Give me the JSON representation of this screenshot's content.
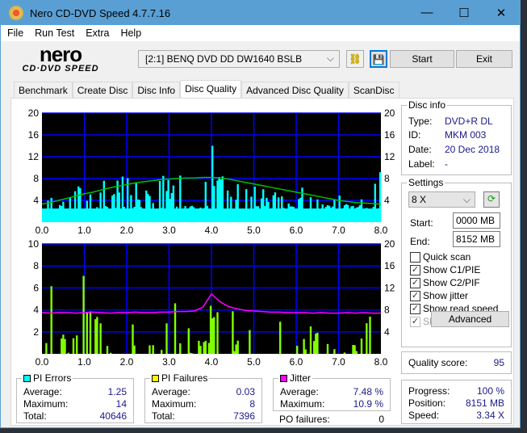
{
  "window": {
    "title": "Nero CD-DVD Speed 4.7.7.16"
  },
  "menu": [
    "File",
    "Run Test",
    "Extra",
    "Help"
  ],
  "toolbar": {
    "logo_top": "nero",
    "logo_bottom": "CD·DVD SPEED",
    "drive": "[2:1]   BENQ DVD DD DW1640 BSLB",
    "start": "Start",
    "exit": "Exit"
  },
  "tabs": [
    "Benchmark",
    "Create Disc",
    "Disc Info",
    "Disc Quality",
    "Advanced Disc Quality",
    "ScanDisc"
  ],
  "active_tab": "Disc Quality",
  "disc_info": {
    "title": "Disc info",
    "type_label": "Type:",
    "type": "DVD+R DL",
    "id_label": "ID:",
    "id": "MKM 003",
    "date_label": "Date:",
    "date": "20 Dec 2018",
    "label_label": "Label:",
    "label": "-"
  },
  "settings": {
    "title": "Settings",
    "speed": "8 X",
    "start_label": "Start:",
    "start": "0000 MB",
    "end_label": "End:",
    "end": "8152 MB",
    "checks": [
      {
        "label": "Quick scan",
        "checked": false
      },
      {
        "label": "Show C1/PIE",
        "checked": true
      },
      {
        "label": "Show C2/PIF",
        "checked": true
      },
      {
        "label": "Show jitter",
        "checked": true
      },
      {
        "label": "Show read speed",
        "checked": true
      },
      {
        "label": "Show write speed",
        "checked": true,
        "disabled": true
      }
    ],
    "advanced": "Advanced"
  },
  "quality": {
    "label": "Quality score:",
    "value": "95"
  },
  "progress": {
    "progress_label": "Progress:",
    "progress": "100 %",
    "position_label": "Position:",
    "position": "8151 MB",
    "speed_label": "Speed:",
    "speed": "3.34 X"
  },
  "pi_errors": {
    "title": "PI Errors",
    "color": "#00ffff",
    "average_label": "Average:",
    "average": "1.25",
    "maximum_label": "Maximum:",
    "maximum": "14",
    "total_label": "Total:",
    "total": "40646"
  },
  "pi_failures": {
    "title": "PI Failures",
    "color": "#ffff00",
    "average_label": "Average:",
    "average": "0.03",
    "maximum_label": "Maximum:",
    "maximum": "8",
    "total_label": "Total:",
    "total": "7396"
  },
  "jitter": {
    "title": "Jitter",
    "color": "#ff00ff",
    "average_label": "Average:",
    "average": "7.48 %",
    "maximum_label": "Maximum:",
    "maximum": "10.9 %",
    "po_label": "PO failures:",
    "po": "0"
  },
  "chart_data": [
    {
      "type": "bar",
      "name": "PI Errors",
      "xlim": [
        0,
        8
      ],
      "ylim_left": [
        0,
        20
      ],
      "ylim_right": [
        0,
        20
      ],
      "xticks": [
        "0.0",
        "1.0",
        "2.0",
        "3.0",
        "4.0",
        "5.0",
        "6.0",
        "7.0",
        "8.0"
      ],
      "yticks_left": [
        "4",
        "8",
        "12",
        "16",
        "20"
      ],
      "yticks_right": [
        "4",
        "8",
        "12",
        "16",
        "20"
      ],
      "grid": true,
      "x": [
        0,
        0.2,
        0.4,
        0.6,
        0.8,
        1.0,
        1.2,
        1.4,
        1.6,
        1.8,
        2.0,
        2.2,
        2.4,
        2.6,
        2.8,
        3.0,
        3.2,
        3.4,
        3.6,
        3.8,
        4.0,
        4.2,
        4.4,
        4.6,
        4.8,
        5.0,
        5.2,
        5.4,
        5.6,
        5.8,
        6.0,
        6.2,
        6.4,
        6.6,
        6.8,
        7.0,
        7.2,
        7.4,
        7.6,
        7.8,
        8.0
      ],
      "pi_errors": [
        3,
        5,
        6,
        4,
        7,
        6,
        8,
        9,
        7,
        8,
        9,
        8,
        8,
        7,
        9,
        8,
        9,
        9,
        8,
        10,
        14,
        9,
        8,
        8,
        7,
        8,
        7,
        6,
        7,
        6,
        7,
        6,
        6,
        5,
        7,
        5,
        5,
        4,
        5,
        9,
        11
      ],
      "read_speed": [
        3.3,
        3.6,
        4.0,
        4.4,
        4.8,
        5.2,
        5.5,
        5.9,
        6.3,
        6.6,
        6.9,
        7.2,
        7.4,
        7.6,
        7.8,
        7.9,
        8.0,
        8.1,
        8.1,
        8.2,
        8.2,
        8.1,
        7.9,
        7.6,
        7.3,
        7.0,
        6.7,
        6.4,
        6.1,
        5.8,
        5.5,
        5.2,
        4.9,
        4.6,
        4.3,
        4.0,
        3.8,
        3.6,
        3.5,
        3.4,
        3.3
      ]
    },
    {
      "type": "bar",
      "name": "PI Failures",
      "xlim": [
        0,
        8
      ],
      "ylim_left": [
        0,
        10
      ],
      "ylim_right": [
        0,
        20
      ],
      "xticks": [
        "0.0",
        "1.0",
        "2.0",
        "3.0",
        "4.0",
        "5.0",
        "6.0",
        "7.0",
        "8.0"
      ],
      "yticks_left": [
        "2",
        "4",
        "6",
        "8",
        "10"
      ],
      "yticks_right": [
        "4",
        "8",
        "12",
        "16",
        "20"
      ],
      "grid": true,
      "x": [
        0,
        0.2,
        0.4,
        0.6,
        0.8,
        1.0,
        1.2,
        1.4,
        1.6,
        1.8,
        2.0,
        2.2,
        2.4,
        2.6,
        2.8,
        3.0,
        3.2,
        3.4,
        3.6,
        3.8,
        4.0,
        4.2,
        4.4,
        4.6,
        4.8,
        5.0,
        5.2,
        5.4,
        5.6,
        5.8,
        6.0,
        6.2,
        6.4,
        6.6,
        6.8,
        7.0,
        7.2,
        7.4,
        7.6,
        7.8,
        8.0
      ],
      "pi_failures": [
        2,
        7,
        3,
        2,
        4,
        8,
        3,
        5,
        2,
        3,
        6,
        2,
        3,
        2,
        1,
        4,
        7,
        3,
        2,
        3,
        8,
        3,
        6,
        2,
        2,
        3,
        2,
        2,
        3,
        2,
        2,
        2,
        3,
        2,
        3,
        2,
        2,
        2,
        3,
        7,
        8
      ],
      "jitter": [
        7.5,
        7.4,
        7.5,
        7.5,
        7.4,
        7.5,
        7.6,
        7.5,
        7.4,
        7.5,
        7.5,
        7.6,
        7.5,
        7.5,
        7.6,
        7.6,
        7.7,
        7.7,
        7.8,
        8.5,
        10.9,
        9.5,
        8.6,
        8.2,
        7.9,
        7.8,
        7.7,
        7.6,
        7.6,
        7.5,
        7.5,
        7.5,
        7.4,
        7.5,
        7.4,
        7.4,
        7.5,
        7.4,
        7.5,
        7.4,
        7.4
      ]
    }
  ]
}
